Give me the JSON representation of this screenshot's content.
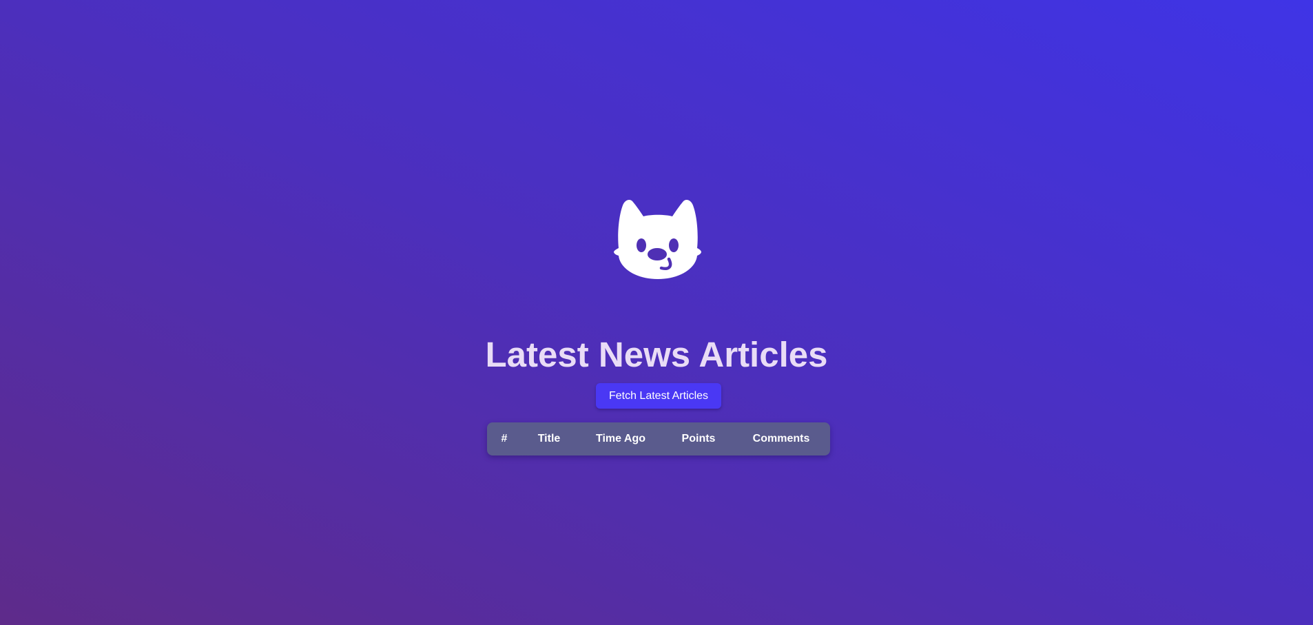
{
  "page": {
    "title": "Latest News Articles"
  },
  "logo": {
    "icon": "cat-face-icon",
    "color": "#ffffff"
  },
  "actions": {
    "fetch_label": "Fetch Latest Articles"
  },
  "table": {
    "columns": [
      "#",
      "Title",
      "Time Ago",
      "Points",
      "Comments"
    ],
    "rows": []
  },
  "colors": {
    "background_start": "#5e2b8a",
    "background_end": "#3f34e6",
    "button": "#4a38f4",
    "table_header": "#5a5b8d",
    "title_text": "#e9dcf6"
  }
}
